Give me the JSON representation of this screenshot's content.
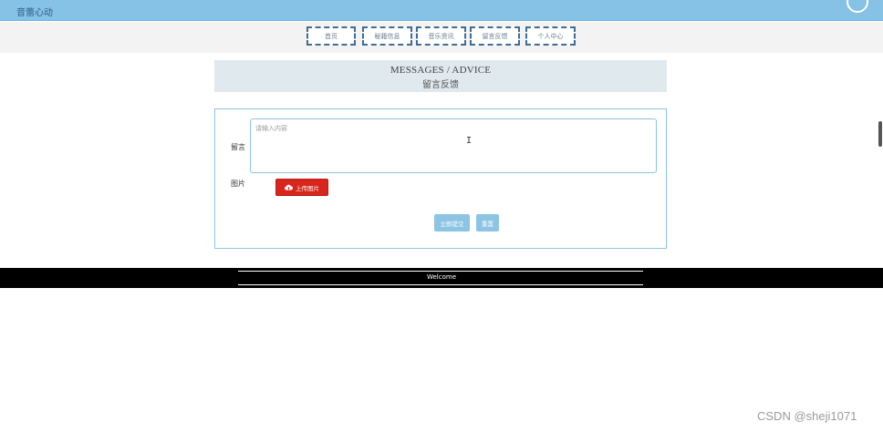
{
  "header": {
    "brand": "音蕾心动"
  },
  "nav": {
    "items": [
      {
        "label": "首页"
      },
      {
        "label": "秘籍信息"
      },
      {
        "label": "音乐资讯"
      },
      {
        "label": "留言反馈"
      },
      {
        "label": "个人中心"
      }
    ]
  },
  "section": {
    "title_en": "MESSAGES / ADVICE",
    "title_cn": "留言反馈"
  },
  "form": {
    "message_label": "留言",
    "message_placeholder": "请输入内容",
    "image_label": "图片",
    "upload_label": "上传图片",
    "submit_label": "立即提交",
    "reset_label": "重置"
  },
  "footer": {
    "text": "Welcome"
  },
  "watermark": "CSDN @sheji1071",
  "colors": {
    "topbar": "#86c1e6",
    "accent": "#8cc4e4",
    "upload": "#d9261c",
    "footer": "#000000"
  },
  "icons": {
    "upload": "cloud-upload-icon"
  }
}
